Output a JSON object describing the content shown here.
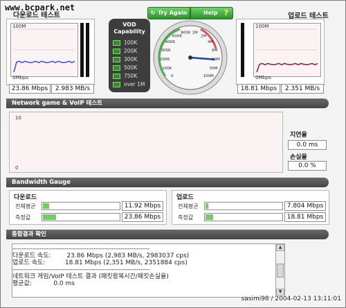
{
  "watermark": "www.bcpark.net",
  "download_panel": {
    "title": "다운로드 테스트",
    "y_max": "100M",
    "y_min": "0Mbps",
    "speed_mbps": "23.86 Mbps",
    "speed_mbs": "2.983 MB/s",
    "level": 0.24
  },
  "upload_panel": {
    "title": "업로드 테스트",
    "y_max": "100M",
    "y_min": "0Mbps",
    "speed_mbps": "18.81 Mbps",
    "speed_mbs": "2.351 MB/s",
    "level": 0.19
  },
  "vod": {
    "title_line1": "VOD",
    "title_line2": "Capability",
    "levels": [
      "100K",
      "200K",
      "300K",
      "500K",
      "750K",
      "over 1M"
    ]
  },
  "buttons": {
    "try_again": "Try Again",
    "help": "Help",
    "help_icon": "?"
  },
  "gauge": {
    "ticks": [
      "0",
      "100K",
      "200K",
      "300K",
      "400K",
      "600K",
      "800K",
      "1M",
      "2M",
      "4M",
      "6M",
      "10M",
      "50M",
      "100M"
    ],
    "value_label": "23.86 Mbps"
  },
  "network_game": {
    "section_title": "Network game & VoIP 테스트",
    "y_max": "10",
    "y_min": "0",
    "latency_label": "지연율",
    "latency_value": "0.0 ms",
    "loss_label": "손실율",
    "loss_value": "0.0 %"
  },
  "bandwidth": {
    "section_title": "Bandwidth Gauge",
    "download": {
      "title": "다운로드",
      "avg_label": "전체평균",
      "avg_value": "11.92 Mbps",
      "avg_fill": 0.08,
      "meas_label": "측정값",
      "meas_value": "23.86 Mbps",
      "meas_fill": 0.17
    },
    "upload": {
      "title": "업로드",
      "avg_label": "전체평균",
      "avg_value": "7.804 Mbps",
      "avg_fill": 0.04,
      "meas_label": "측정값",
      "meas_value": "18.81 Mbps",
      "meas_fill": 0.1
    }
  },
  "summary": {
    "section_title": "종합결과 확인",
    "lines": [
      "-------------------------------------------------------------",
      "다운로드 속도:        23.86 Mbps (2,983 MB/s, 2983037 cps)",
      "업로드 속도:          18.81 Mbps (2,351 MB/s, 2351884 cps)",
      "-------------------------------------------------------------",
      "네트워크 게임/VoIP 테스트 결과 (패킷왕복시간/패킷손실율)",
      "",
      "평균값:           0.0 ms"
    ]
  },
  "footer": "sasimi98 / 2004-02-13 13:11:01",
  "colors": {
    "accent_green": "#77c867",
    "dark_bar": "#444444",
    "download_line": "#3b4fd1",
    "upload_line": "#8a1f3a",
    "needle": "#1f3fa8"
  }
}
